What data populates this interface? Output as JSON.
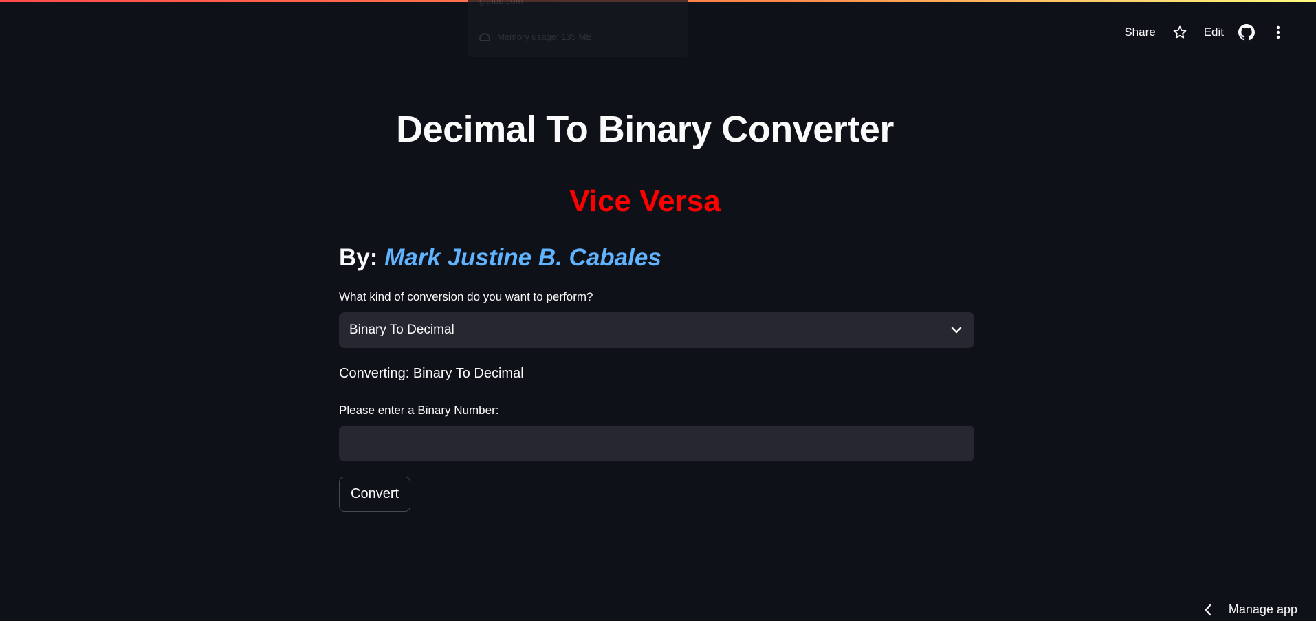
{
  "background_tooltip": {
    "line1": "github.com",
    "line2": "Memory usage: 135 MB"
  },
  "toolbar": {
    "share_label": "Share",
    "star_icon": "star-icon",
    "edit_label": "Edit",
    "github_icon": "github-icon",
    "menu_icon": "kebab-menu-icon"
  },
  "main": {
    "title": "Decimal To Binary Converter",
    "subtitle": "Vice Versa",
    "byline_prefix": "By: ",
    "author": "Mark Justine B. Cabales",
    "conversion_label": "What kind of conversion do you want to perform?",
    "conversion_selected": "Binary To Decimal",
    "status_text": "Converting: Binary To Decimal",
    "input_label": "Please enter a Binary Number:",
    "input_value": "",
    "convert_label": "Convert"
  },
  "footer": {
    "manage_app_label": "Manage app"
  },
  "colors": {
    "background": "#0e1117",
    "subtitle": "#ff0000",
    "author": "#60b4ff",
    "input_bg": "#262730"
  }
}
